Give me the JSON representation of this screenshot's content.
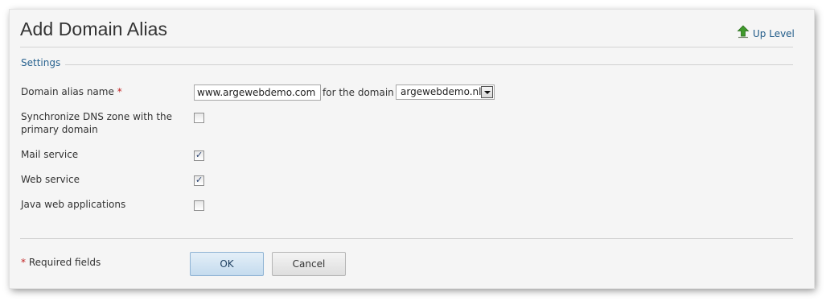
{
  "page": {
    "title": "Add Domain Alias",
    "up_level_label": "Up Level"
  },
  "section": {
    "legend": "Settings"
  },
  "form": {
    "alias_label": "Domain alias name",
    "required_marker": "*",
    "alias_value": "www.argewebdemo.com",
    "for_domain_text": "for the domain",
    "domain_select_value": "argewebdemo.nl",
    "sync_dns_label": "Synchronize DNS zone with the primary domain",
    "mail_label": "Mail service",
    "web_label": "Web service",
    "java_label": "Java web applications",
    "checkmark": "✓"
  },
  "state": {
    "sync_dns": false,
    "mail_service": true,
    "web_service": true,
    "java_web": false
  },
  "footer": {
    "required_note_marker": "*",
    "required_note": "Required fields",
    "ok_label": "OK",
    "cancel_label": "Cancel"
  },
  "icons": {
    "up_level": "green-up-arrow-icon",
    "select_arrow": "chevron-down-icon"
  },
  "colors": {
    "link": "#1f5a88",
    "legend": "#28628f",
    "required": "#c01f1f",
    "checkmark": "#29416f",
    "up_arrow_green": "#3f9a2b"
  }
}
